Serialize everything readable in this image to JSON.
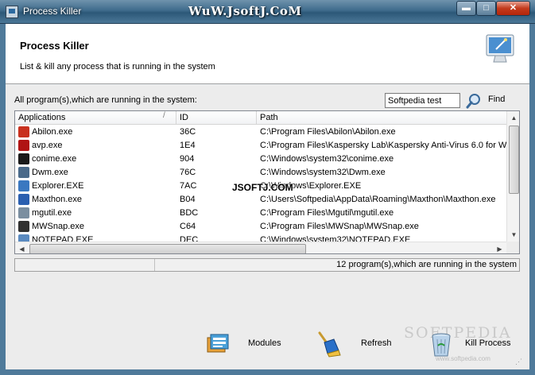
{
  "window": {
    "title": "Process Killer",
    "watermark": "WuW.JsoftJ.CoM",
    "minimize_glyph": "▬",
    "maximize_glyph": "□",
    "close_glyph": "✕"
  },
  "header": {
    "title": "Process Killer",
    "subtitle": "List & kill any process that is running in the system",
    "icon": "monitor-wand-icon"
  },
  "search": {
    "label": "All program(s),which are running in the system:",
    "value": "Softpedia test",
    "find_label": "Find"
  },
  "list": {
    "columns": [
      "Applications",
      "ID",
      "Path"
    ],
    "sort_glyph": "/",
    "rows": [
      {
        "name": "Abilon.exe",
        "id": "36C",
        "path": "C:\\Program Files\\Abilon\\Abilon.exe",
        "icon": "abilon-icon",
        "color": "#c8301e"
      },
      {
        "name": "avp.exe",
        "id": "1E4",
        "path": "C:\\Program Files\\Kaspersky Lab\\Kaspersky Anti-Virus 6.0 for Win",
        "icon": "kaspersky-icon",
        "color": "#b01414"
      },
      {
        "name": "conime.exe",
        "id": "904",
        "path": "C:\\Windows\\system32\\conime.exe",
        "icon": "console-icon",
        "color": "#1a1a1a"
      },
      {
        "name": "Dwm.exe",
        "id": "76C",
        "path": "C:\\Windows\\system32\\Dwm.exe",
        "icon": "window-icon",
        "color": "#4a6a8a"
      },
      {
        "name": "Explorer.EXE",
        "id": "7AC",
        "path": "C:\\Windows\\Explorer.EXE",
        "icon": "explorer-icon",
        "color": "#3a78c0"
      },
      {
        "name": "Maxthon.exe",
        "id": "B04",
        "path": "C:\\Users\\Softpedia\\AppData\\Roaming\\Maxthon\\Maxthon.exe",
        "icon": "maxthon-icon",
        "color": "#2a5fb0"
      },
      {
        "name": "mgutil.exe",
        "id": "BDC",
        "path": "C:\\Program Files\\Mgutil\\mgutil.exe",
        "icon": "mgutil-icon",
        "color": "#7a8ea0"
      },
      {
        "name": "MWSnap.exe",
        "id": "C64",
        "path": "C:\\Program Files\\MWSnap\\MWSnap.exe",
        "icon": "camera-icon",
        "color": "#303030"
      },
      {
        "name": "NOTEPAD.EXE",
        "id": "DEC",
        "path": "C:\\Windows\\system32\\NOTEPAD.EXE",
        "icon": "notepad-icon",
        "color": "#5a8ac0"
      }
    ],
    "scroll_up": "▲",
    "scroll_down": "▼",
    "scroll_left": "◀",
    "scroll_right": "▶"
  },
  "status": {
    "text": "12 program(s),which are running in the system"
  },
  "overlay_watermark": "JSOFTJ.COM",
  "toolbar": {
    "modules_label": "Modules",
    "refresh_label": "Refresh",
    "kill_label": "Kill Process"
  },
  "softpedia": {
    "logo": "SOFTPEDIA",
    "sub": "www.softpedia.com"
  },
  "colors": {
    "titlebar": "#3f6b8c",
    "frame": "#4f7a9a",
    "close": "#c33a1c"
  }
}
